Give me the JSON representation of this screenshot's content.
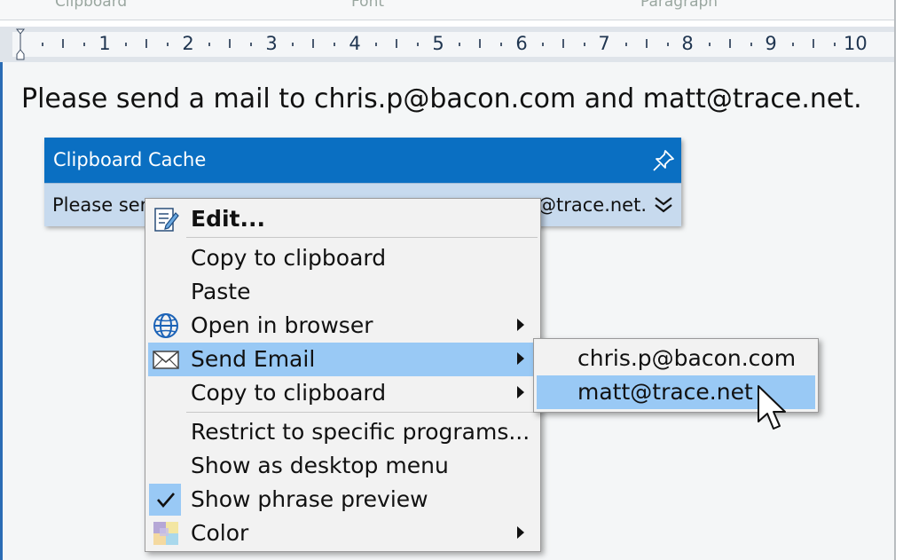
{
  "ribbon": {
    "groups": [
      "Clipboard",
      "Font",
      "Paragraph"
    ]
  },
  "ruler": {
    "numbers": [
      "1",
      "2",
      "3",
      "4",
      "5",
      "6",
      "7",
      "8",
      "9",
      "10"
    ]
  },
  "document": {
    "text": "Please send a mail to chris.p@bacon.com and matt@trace.net."
  },
  "clipboard_cache": {
    "title": "Clipboard Cache",
    "entry_start": "Please sen",
    "entry_end": "@trace.net."
  },
  "context_menu": {
    "items": [
      {
        "label": "Edit...",
        "icon": "edit-icon",
        "submenu": false
      },
      {
        "label": "Copy to clipboard",
        "submenu": false
      },
      {
        "label": "Paste",
        "submenu": false
      },
      {
        "label": "Open in browser",
        "icon": "globe-icon",
        "submenu": true
      },
      {
        "label": "Send Email",
        "icon": "envelope-icon",
        "submenu": true,
        "highlighted": true
      },
      {
        "label": "Copy to clipboard",
        "submenu": true
      },
      {
        "label": "Restrict to specific programs...",
        "submenu": false
      },
      {
        "label": "Show as desktop menu",
        "submenu": false
      },
      {
        "label": "Show phrase preview",
        "icon": "checkmark-icon",
        "checked": true
      },
      {
        "label": "Color",
        "icon": "color-palette-icon",
        "submenu": true
      }
    ]
  },
  "email_submenu": {
    "items": [
      {
        "label": "chris.p@bacon.com"
      },
      {
        "label": "matt@trace.net",
        "highlighted": true
      }
    ]
  },
  "colors": {
    "accent": "#0a6fc2",
    "highlight": "#99c9f5",
    "cache_row": "#c7daee"
  }
}
